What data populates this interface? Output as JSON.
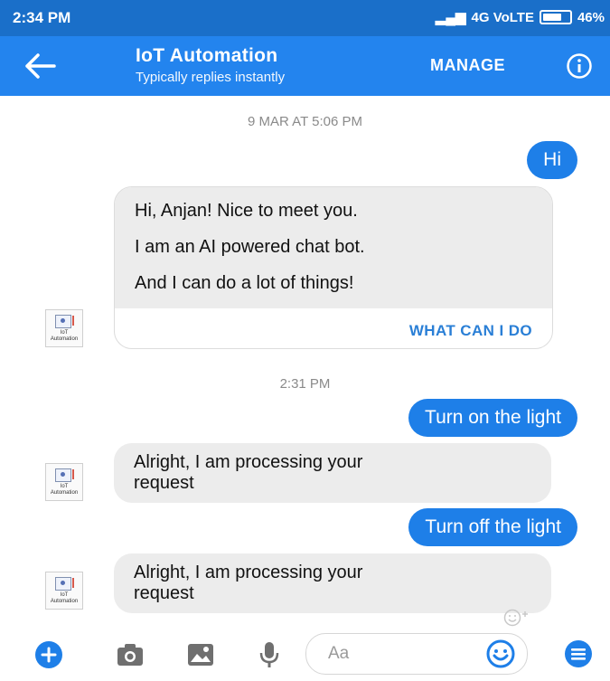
{
  "status": {
    "time": "2:34 PM",
    "network": "4G VoLTE",
    "battery": "46%"
  },
  "header": {
    "title": "IoT Automation",
    "subtitle": "Typically replies instantly",
    "manage_label": "MANAGE"
  },
  "chat": {
    "timestamp_1": "9 MAR AT 5:06 PM",
    "msg_hi": "Hi",
    "card_lines": [
      "Hi, Anjan! Nice to meet you.",
      "I am an AI powered chat bot.",
      "And I can do a lot of things!"
    ],
    "card_action": "WHAT CAN I DO",
    "timestamp_2": "2:31 PM",
    "msg_on": "Turn on the light",
    "reply_1_line1": "Alright, I am processing your",
    "reply_1_line2": "request",
    "msg_off": "Turn off the light",
    "reply_2_line1": "Alright, I am processing your",
    "reply_2_line2": "request",
    "avatar_label": "IoT Automation"
  },
  "composer": {
    "placeholder": "Aa"
  },
  "colors": {
    "header_bg": "#2384ee",
    "status_bg": "#1a6fc9",
    "accent": "#1e7fe8",
    "incoming_bubble": "#ececec"
  },
  "icons": [
    "back-arrow-icon",
    "info-icon",
    "plus-icon",
    "camera-icon",
    "image-icon",
    "microphone-icon",
    "emoji-icon",
    "menu-icon",
    "reaction-icon"
  ]
}
